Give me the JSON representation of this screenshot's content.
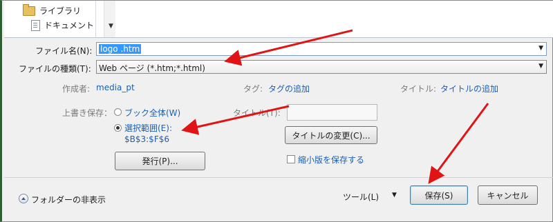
{
  "nav": {
    "items": [
      {
        "label": "ライブラリ",
        "icon": "library-folder-icon"
      },
      {
        "label": "ドキュメント",
        "icon": "document-icon"
      }
    ]
  },
  "form": {
    "filename_label": "ファイル名(N):",
    "filename_value": "logo .htm",
    "filetype_label": "ファイルの種類(T):",
    "filetype_value": "Web ページ (*.htm;*.html)",
    "author_label": "作成者:",
    "author_value": "media_pt",
    "tags_label": "タグ:",
    "tags_value": "タグの追加",
    "title_label": "タイトル:",
    "title_value": "タイトルの追加"
  },
  "save_options": {
    "overwrite_label": "上書き保存：",
    "option_workbook": "ブック全体(W)",
    "option_selection": "選択範囲(E):",
    "selection_range": "$B$3:$F$6",
    "publish_button": "発行(P)...",
    "title_field_label": "タイトル(T):",
    "title_field_value": "",
    "change_title_button": "タイトルの変更(C)...",
    "thumbnail_checkbox": "縮小版を保存する",
    "selected_option": "selection"
  },
  "footer": {
    "hide_folders": "フォルダーの非表示",
    "tools": "ツール(L)",
    "save_button": "保存(S)",
    "cancel_button": "キャンセル"
  },
  "colors": {
    "annotation_arrow": "#e01414",
    "link": "#1a5fb4",
    "selection": "#3399ff"
  }
}
